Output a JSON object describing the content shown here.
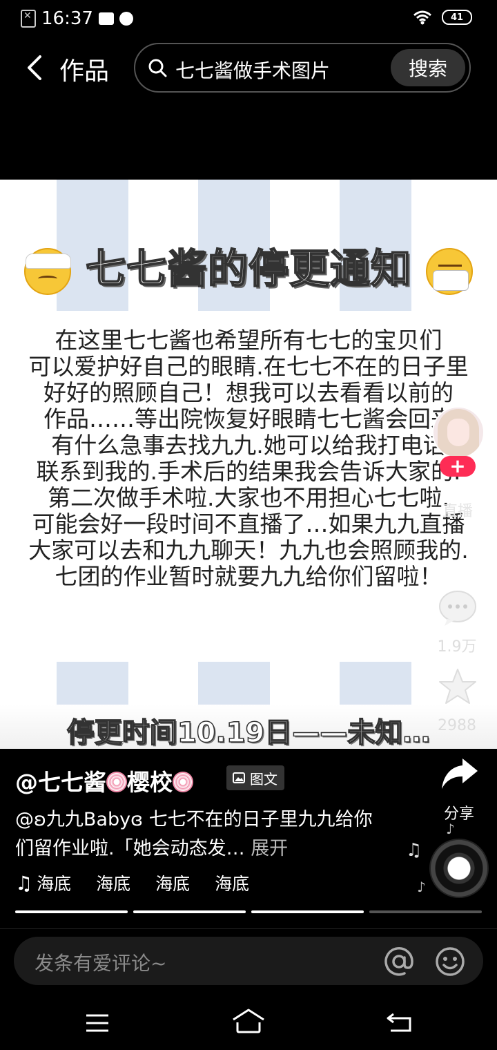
{
  "status_bar": {
    "time": "16:37",
    "battery": "41"
  },
  "top_bar": {
    "title": "作品",
    "search_query": "七七酱做手术图片",
    "search_button": "搜索"
  },
  "post": {
    "headline": "七七酱的停更通知",
    "notice_lines": [
      "在这里七七酱也希望所有七七的宝贝们",
      "可以爱护好自己的眼睛.在七七不在的日子里",
      "好好的照顾自己！想我可以去看看以前的",
      "作品……等出院恢复好眼睛七七酱会回来",
      "有什么急事去找九九.她可以给我打电话",
      "联系到我的.手术后的结果我会告诉大家的.",
      "第二次做手术啦.大家也不用担心七七啦.",
      "可能会好一段时间不直播了…如果九九直播",
      "大家可以去和九九聊天！九九也会照顾我的.",
      "七团的作业暂时就要九九给你们留啦！"
    ],
    "footer_date": "停更时间10.19日——未知…"
  },
  "actions": {
    "follow_label": "+",
    "live_label": "直播",
    "comment_count": "1.9万",
    "favorite_count": "2988",
    "share_label": "分享"
  },
  "author": {
    "name_prefix": "@七七酱",
    "name_middle": "樱校",
    "type_badge": "图文"
  },
  "description": {
    "text": "@ʚ九九Babyɞ 七七不在的日子里九九给你们留作业啦.「她会动态发…",
    "expand_label": "展开"
  },
  "music": {
    "items": [
      "海底",
      "海底",
      "海底",
      "海底"
    ]
  },
  "progress": {
    "segments_total": 4,
    "segments_viewed": 3
  },
  "comment_bar": {
    "placeholder": "发条有爱评论~"
  },
  "colors": {
    "accent": "#fe2c55",
    "stripe": "#dbe4f1",
    "search_btn_bg": "#333333"
  }
}
